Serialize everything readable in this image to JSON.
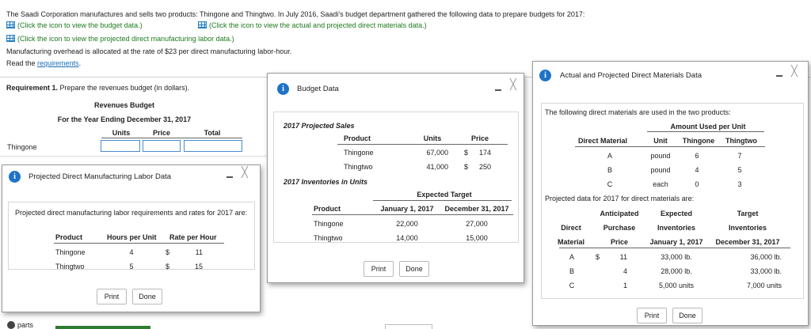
{
  "intro": {
    "line1": "The Saadi Corporation manufactures and sells two products: Thingone and Thingtwo. In July 2016, Saadi's budget department gathered the following data to prepare budgets for 2017:",
    "link_budget": "(Click the icon to view the budget data.)",
    "link_materials": "(Click the icon to view the actual and projected direct materials data.)",
    "link_labor": "(Click the icon to view the projected direct manufacturing labor data.)",
    "overhead": "Manufacturing overhead is allocated at the rate of $23 per direct manufacturing labor-hour.",
    "read_prefix": "Read the ",
    "read_link": "requirements",
    "read_suffix": "."
  },
  "requirement": {
    "label": "Requirement 1.",
    "text": " Prepare the revenues budget (in dollars).",
    "title": "Revenues Budget",
    "subtitle": "For the Year Ending December 31, 2017",
    "col_units": "Units",
    "col_price": "Price",
    "col_total": "Total",
    "row1": "Thingone",
    "bottom_text": "parts"
  },
  "labor_win": {
    "title": "Projected Direct Manufacturing Labor Data",
    "desc": "Projected direct manufacturing labor requirements and rates for 2017 are:",
    "headers": [
      "Product",
      "Hours per Unit",
      "Rate per Hour"
    ],
    "rows": [
      {
        "product": "Thingone",
        "hours": "4",
        "dollar": "$",
        "rate": "11"
      },
      {
        "product": "Thingtwo",
        "hours": "5",
        "dollar": "$",
        "rate": "15"
      }
    ],
    "print": "Print",
    "done": "Done"
  },
  "budget_win": {
    "title": "Budget Data",
    "sales_heading": "2017 Projected Sales",
    "sales_headers": [
      "Product",
      "Units",
      "Price"
    ],
    "sales_rows": [
      {
        "product": "Thingone",
        "units": "67,000",
        "dollar": "$",
        "price": "174"
      },
      {
        "product": "Thingtwo",
        "units": "41,000",
        "dollar": "$",
        "price": "250"
      }
    ],
    "inv_heading": "2017 Inventories in Units",
    "inv_group": "Expected Target",
    "inv_headers": [
      "Product",
      "January 1, 2017",
      "December 31, 2017"
    ],
    "inv_rows": [
      {
        "product": "Thingone",
        "jan": "22,000",
        "dec": "27,000"
      },
      {
        "product": "Thingtwo",
        "jan": "14,000",
        "dec": "15,000"
      }
    ],
    "print": "Print",
    "done": "Done"
  },
  "materials_win": {
    "title": "Actual and Projected Direct Materials Data",
    "desc": "The following direct materials are used in the two products:",
    "group": "Amount Used per Unit",
    "headers": [
      "Direct Material",
      "Unit",
      "Thingone",
      "Thingtwo"
    ],
    "rows": [
      {
        "mat": "A",
        "unit": "pound",
        "one": "6",
        "two": "7"
      },
      {
        "mat": "B",
        "unit": "pound",
        "one": "4",
        "two": "5"
      },
      {
        "mat": "C",
        "unit": "each",
        "one": "0",
        "two": "3"
      }
    ],
    "proj_desc": "Projected data for 2017 for direct materials are:",
    "h1": [
      "",
      "Anticipated",
      "Expected",
      "Target"
    ],
    "h2": [
      "Direct",
      "Purchase",
      "Inventories",
      "Inventories"
    ],
    "h3": [
      "Material",
      "Price",
      "January 1, 2017",
      "December 31, 2017"
    ],
    "proj_rows": [
      {
        "mat": "A",
        "dollar": "$",
        "price": "11",
        "jan": "33,000 lb.",
        "dec": "36,000 lb."
      },
      {
        "mat": "B",
        "dollar": "",
        "price": "4",
        "jan": "28,000 lb.",
        "dec": "33,000 lb."
      },
      {
        "mat": "C",
        "dollar": "",
        "price": "1",
        "jan": "5,000 units",
        "dec": "7,000 units"
      }
    ],
    "print": "Print",
    "done": "Done"
  }
}
